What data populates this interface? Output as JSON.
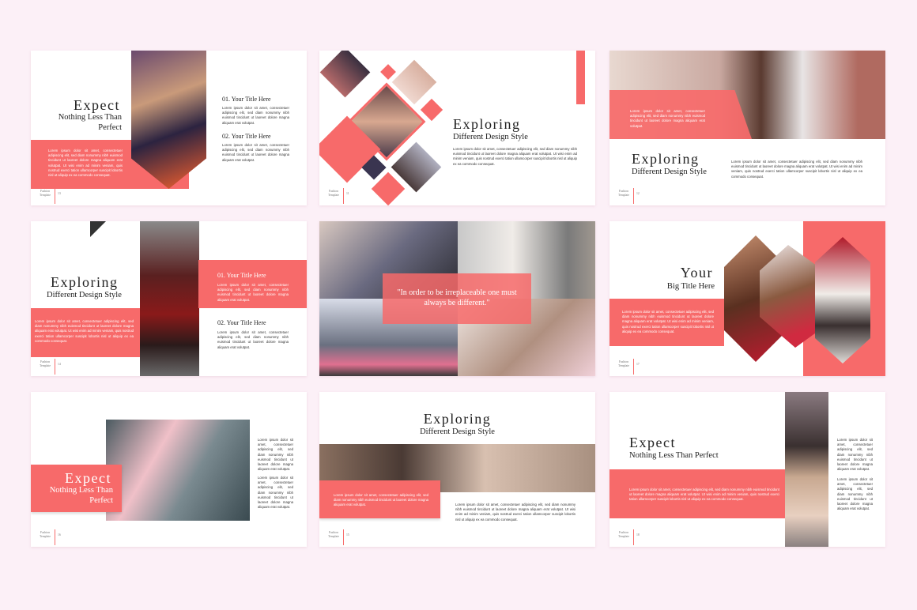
{
  "colors": {
    "accent": "#f76a6a",
    "background": "#fcf0f7",
    "slide": "#ffffff"
  },
  "lorem_long": "Lorem ipsum dolor sit amet, consectetuer adipiscing elit, sed diam nonummy nibh euismod tincidunt ut laoreet dolore magna aliquam erat volutpat. Ut wisi enim ad minim veniam, quis nostrud exerci tation ullamcorper suscipit lobortis nisl ut aliquip ex ea commodo consequat.",
  "lorem_short": "Lorem ipsum dolor sit amet, consectetuer adipiscing elit, sed diam nonummy nibh euismod tincidunt ut laoreet dolore magna aliquam erat volutpat.",
  "footer": "Fashion Template",
  "slides": [
    {
      "title": "Expect",
      "subtitle": "Nothing Less Than Perfect",
      "item1": "01. Your Title Here",
      "item2": "02. Your Title Here",
      "page": "13"
    },
    {
      "title": "Exploring",
      "subtitle": "Different Design Style",
      "page": "11"
    },
    {
      "title": "Exploring",
      "subtitle": "Different Design Style",
      "page": "12"
    },
    {
      "title": "Exploring",
      "subtitle": "Different Design Style",
      "item1": "01. Your Title Here",
      "item2": "02. Your Title Here",
      "page": "14"
    },
    {
      "quote": "\"In order to be irreplaceable one must always be different.\""
    },
    {
      "title": "Your",
      "subtitle": "Big Title Here",
      "page": "17"
    },
    {
      "title": "Expect",
      "subtitle": "Nothing Less Than Perfect",
      "page": "16"
    },
    {
      "title": "Exploring",
      "subtitle": "Different Design Style",
      "page": "15"
    },
    {
      "title": "Expect",
      "subtitle": "Nothing Less Than Perfect",
      "page": "18"
    }
  ]
}
